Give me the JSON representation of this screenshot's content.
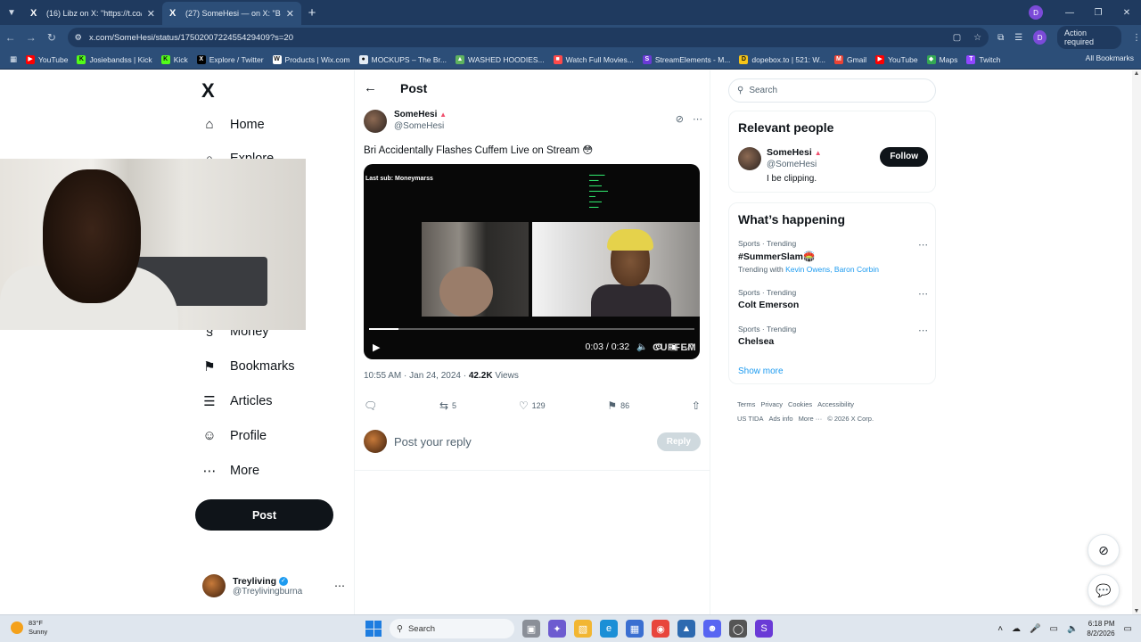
{
  "browser": {
    "tabs": [
      {
        "title": "(16) Libz on X: \"https://t.co/eYo",
        "active": false
      },
      {
        "title": "(27) SomeHesi — on X: \"Bri Acc",
        "active": true
      }
    ],
    "url": "x.com/SomeHesi/status/1750200722455429409?s=20",
    "action_required": "Action required",
    "profile_initial": "D",
    "bookmarks": [
      {
        "label": "YouTube",
        "color": "#ff0000",
        "glyph": "▶"
      },
      {
        "label": "Josiebandss | Kick",
        "color": "#53fc18",
        "glyph": "K"
      },
      {
        "label": "Kick",
        "color": "#53fc18",
        "glyph": "K"
      },
      {
        "label": "Explore / Twitter",
        "color": "#000000",
        "glyph": "X"
      },
      {
        "label": "Products | Wix.com",
        "color": "#ffffff",
        "glyph": "W"
      },
      {
        "label": "MOCKUPS – The Br...",
        "color": "#e4ecf5",
        "glyph": "●"
      },
      {
        "label": "WASHED HOODIES...",
        "color": "#5fb35f",
        "glyph": "▲"
      },
      {
        "label": "Watch Full Movies...",
        "color": "#ff4a4a",
        "glyph": "■"
      },
      {
        "label": "StreamElements - M...",
        "color": "#6a3ad6",
        "glyph": "S"
      },
      {
        "label": "dopebox.to | 521: W...",
        "color": "#f5c518",
        "glyph": "D"
      },
      {
        "label": "Gmail",
        "color": "#ea4335",
        "glyph": "M"
      },
      {
        "label": "YouTube",
        "color": "#ff0000",
        "glyph": "▶"
      },
      {
        "label": "Maps",
        "color": "#34a853",
        "glyph": "◆"
      },
      {
        "label": "Twitch",
        "color": "#9146ff",
        "glyph": "T"
      }
    ],
    "all_bookmarks": "All Bookmarks"
  },
  "nav": {
    "logo": "X",
    "items": [
      {
        "label": "Home",
        "icon": "home-icon",
        "glyph": "⌂"
      },
      {
        "label": "Explore",
        "icon": "search-icon",
        "glyph": "⌕"
      },
      {
        "label": "Money",
        "icon": "money-icon",
        "glyph": "§"
      },
      {
        "label": "Bookmarks",
        "icon": "bookmark-icon",
        "glyph": "⚑"
      },
      {
        "label": "Articles",
        "icon": "articles-icon",
        "glyph": "☰"
      },
      {
        "label": "Profile",
        "icon": "profile-icon",
        "glyph": "☺"
      },
      {
        "label": "More",
        "icon": "more-icon",
        "glyph": "⋯"
      }
    ],
    "post_button": "Post",
    "account": {
      "name": "Treyliving",
      "handle": "@Treylivingburna"
    }
  },
  "post": {
    "header_title": "Post",
    "author_name": "SomeHesi",
    "author_handle": "@SomeHesi",
    "text": "Bri Accidentally Flashes Cuffem Live on Stream 😳",
    "video": {
      "overlay_text": "Last sub: Moneymarss",
      "time": "0:03 / 0:32",
      "progress": 0.09,
      "watermark": "CUFFEM"
    },
    "time": "10:55 AM",
    "date": "Jan 24, 2024",
    "views_count": "42.2K",
    "views_label": "Views",
    "stats": {
      "reposts": "5",
      "likes": "129",
      "bookmarks": "86"
    },
    "reply_placeholder": "Post your reply",
    "reply_button": "Reply"
  },
  "sidebar": {
    "search_placeholder": "Search",
    "relevant_title": "Relevant people",
    "person": {
      "name": "SomeHesi",
      "handle": "@SomeHesi",
      "bio": "I be clipping.",
      "follow": "Follow"
    },
    "happening_title": "What’s happening",
    "trends": [
      {
        "context": "Sports · Trending",
        "title": "#SummerSlam🏟️",
        "with_label": "Trending with",
        "with": "Kevin Owens, Baron Corbin"
      },
      {
        "context": "Sports · Trending",
        "title": "Colt Emerson",
        "with_label": "",
        "with": ""
      },
      {
        "context": "Sports · Trending",
        "title": "Chelsea",
        "with_label": "",
        "with": ""
      }
    ],
    "show_more": "Show more",
    "footer": [
      "Terms",
      "Privacy",
      "Cookies",
      "Accessibility",
      "US TIDA",
      "Ads info",
      "More ···",
      "© 2026 X Corp."
    ]
  },
  "taskbar": {
    "temp": "83°F",
    "condition": "Sunny",
    "search": "Search",
    "time": "6:18 PM",
    "date": "8/2/2026"
  }
}
